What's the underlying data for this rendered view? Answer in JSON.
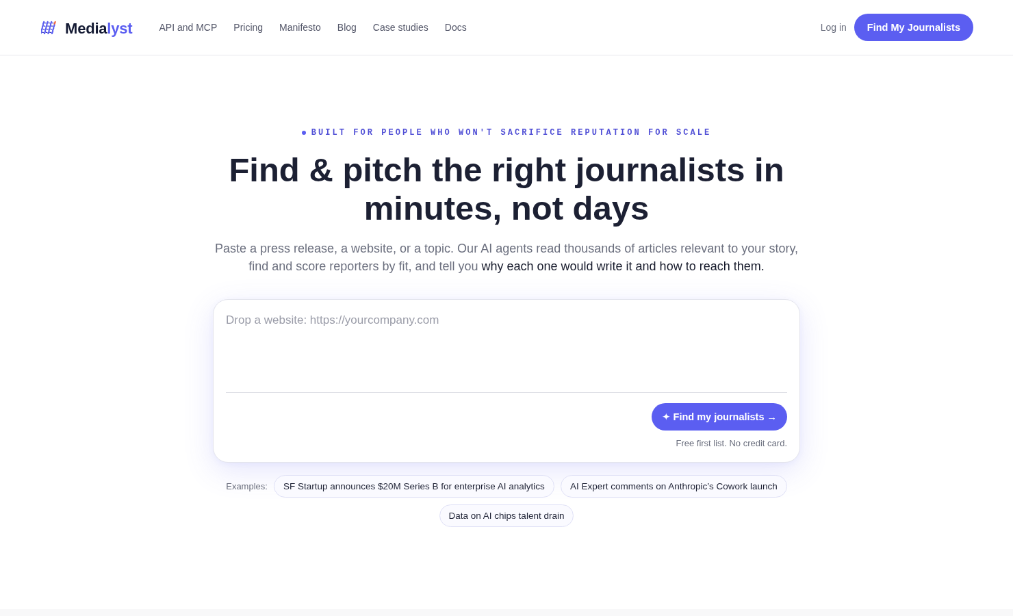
{
  "header": {
    "brand": {
      "lead": "Media",
      "accent": "lyst"
    },
    "nav": [
      "API and MCP",
      "Pricing",
      "Manifesto",
      "Blog",
      "Case studies",
      "Docs"
    ],
    "login": "Log in",
    "cta": "Find My Journalists"
  },
  "hero": {
    "eyebrow": "BUILT FOR PEOPLE WHO WON'T SACRIFICE REPUTATION FOR SCALE",
    "title": "Find & pitch the right journalists in minutes, not days",
    "subtitle": "Paste a press release, a website, or a topic. Our AI agents read thousands of articles relevant to your story, find and score reporters by fit, and tell you **why each one would write it and how to reach them.**"
  },
  "composer": {
    "placeholder": "Drop a website: https://yourcompany.com",
    "submit": "✦ Find my journalists →",
    "note": "Free first list. No credit card."
  },
  "examples": {
    "label": "Examples:",
    "items": [
      "SF Startup announces $20M Series B for enterprise AI analytics",
      "AI Expert comments on Anthropic’s Cowork launch",
      "Data on AI chips talent drain"
    ]
  }
}
